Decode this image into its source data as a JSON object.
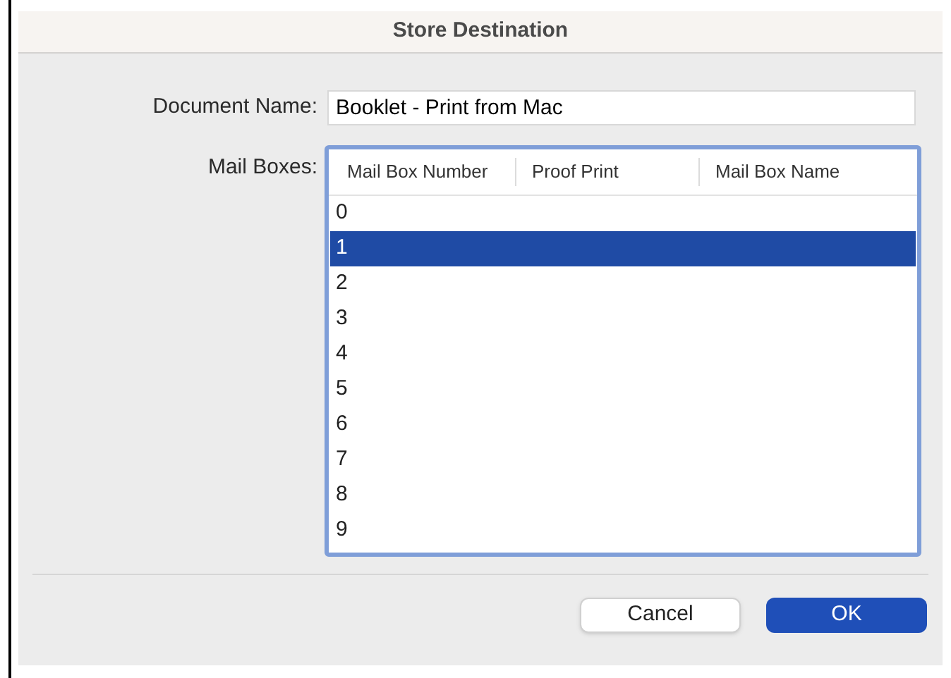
{
  "window": {
    "title": "Store Destination"
  },
  "document_name": {
    "label": "Document Name:",
    "value": "Booklet - Print from Mac"
  },
  "mail_boxes": {
    "label": "Mail Boxes:",
    "columns": [
      "Mail Box Number",
      "Proof Print",
      "Mail Box Name"
    ],
    "rows": [
      {
        "number": "0",
        "selected": false
      },
      {
        "number": "1",
        "selected": true
      },
      {
        "number": "2",
        "selected": false
      },
      {
        "number": "3",
        "selected": false
      },
      {
        "number": "4",
        "selected": false
      },
      {
        "number": "5",
        "selected": false
      },
      {
        "number": "6",
        "selected": false
      },
      {
        "number": "7",
        "selected": false
      },
      {
        "number": "8",
        "selected": false
      },
      {
        "number": "9",
        "selected": false
      }
    ]
  },
  "buttons": [
    {
      "label": "Cancel",
      "kind": "secondary"
    },
    {
      "label": "OK",
      "kind": "primary"
    }
  ]
}
